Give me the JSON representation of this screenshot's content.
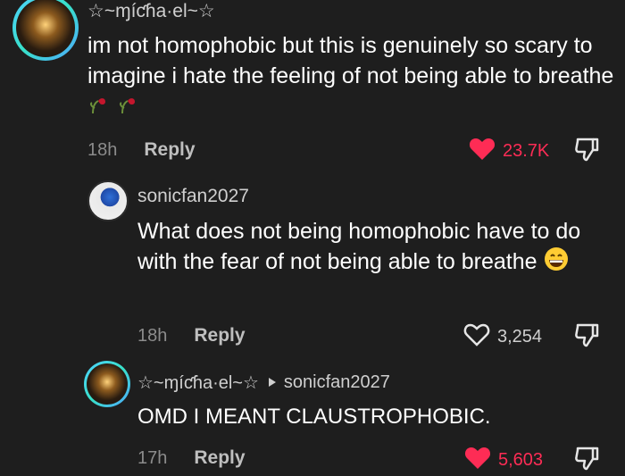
{
  "comments": [
    {
      "username": "☆~ɱíƈɦa·el~☆",
      "text": "im not homophobic but this is genuinely so scary to imagine i hate the feeling of not being able to breathe",
      "emoji_names": [
        "wilted-flower-icon",
        "wilted-flower-icon"
      ],
      "time": "18h",
      "reply_label": "Reply",
      "likes": "23.7K",
      "liked": true
    },
    {
      "username": "sonicfan2027",
      "text": "What does not being homophobic have to do with the fear of not being able to breathe",
      "emoji_names": [
        "grinning-face-icon"
      ],
      "time": "18h",
      "reply_label": "Reply",
      "likes": "3,254",
      "liked": false
    },
    {
      "username": "☆~ɱíƈɦa·el~☆",
      "reply_to": "sonicfan2027",
      "text": "OMD I MEANT CLAUSTROPHOBIC.",
      "time": "17h",
      "reply_label": "Reply",
      "likes": "5,603",
      "liked": true
    }
  ],
  "colors": {
    "background": "#1e1e1e",
    "like_active": "#fe2c55",
    "muted": "#8c8c8c"
  }
}
